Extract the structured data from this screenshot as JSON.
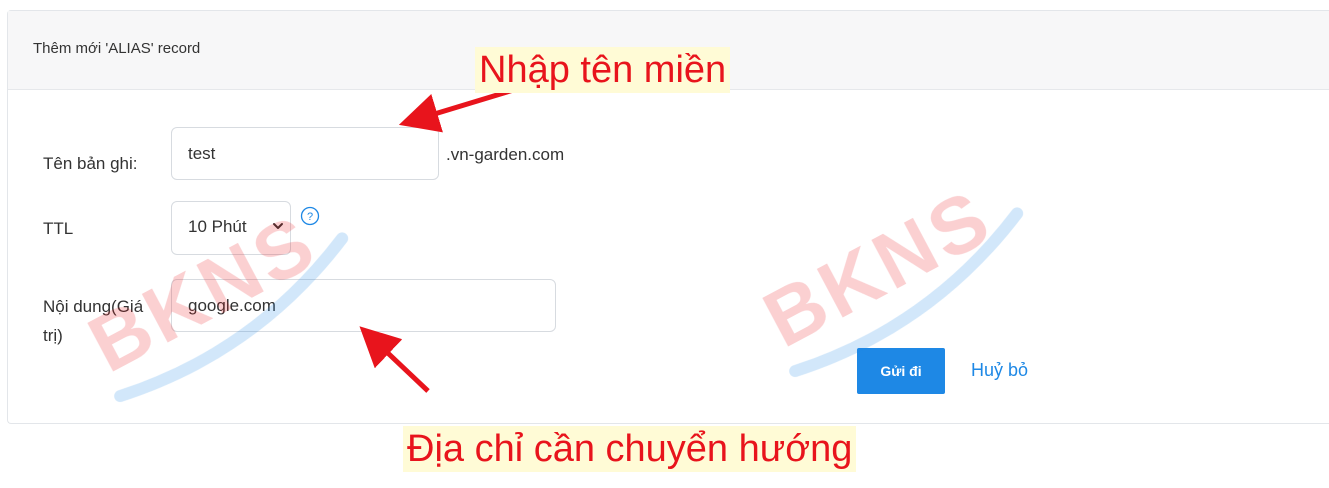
{
  "card": {
    "title": "Thêm mới 'ALIAS' record"
  },
  "form": {
    "record_name": {
      "label": "Tên bản ghi:",
      "value": "test",
      "suffix": ".vn-garden.com"
    },
    "ttl": {
      "label": "TTL",
      "selected": "10 Phút",
      "help_icon": "question-circle-icon"
    },
    "content": {
      "label_line1": "Nội dung(Giá",
      "label_line2": "trị)",
      "value": "google.com"
    },
    "submit_label": "Gửi đi",
    "cancel_label": "Huỷ bỏ"
  },
  "annotations": {
    "top": "Nhập tên miền",
    "bottom": "Địa chỉ cần chuyển hướng"
  },
  "watermark": {
    "text": "BKNS"
  },
  "colors": {
    "primary": "#1e88e5",
    "annotation_red": "#e8141c",
    "annotation_bg": "#fffbd6",
    "header_bg": "#f7f7f8"
  }
}
